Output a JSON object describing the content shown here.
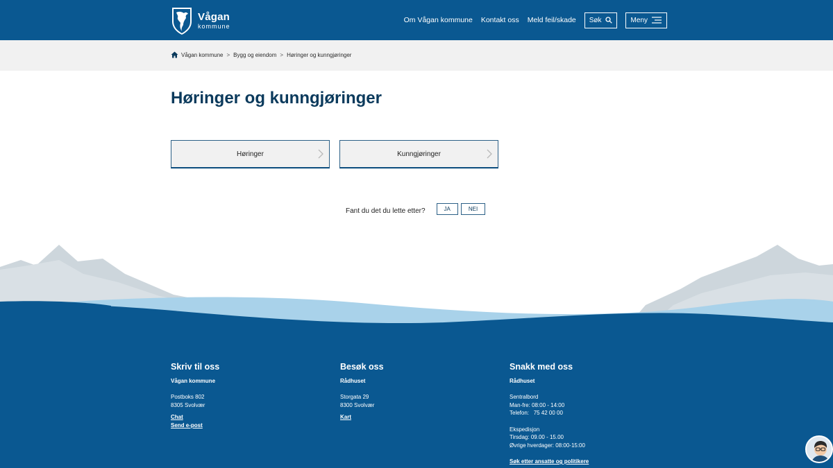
{
  "header": {
    "logo": {
      "title": "Vågan",
      "subtitle": "kommune"
    },
    "nav": {
      "about": "Om Vågan kommune",
      "contact": "Kontakt oss",
      "report": "Meld feil/skade",
      "search": "Søk",
      "menu": "Meny"
    }
  },
  "breadcrumb": {
    "items": [
      "Vågan kommune",
      "Bygg og eiendom",
      "Høringer og kunngjøringer"
    ],
    "separator": ">"
  },
  "main": {
    "title": "Høringer og kunngjøringer",
    "tiles": [
      "Høringer",
      "Kunngjøringer"
    ],
    "feedback": {
      "question": "Fant du det du lette etter?",
      "yes": "JA",
      "no": "NEI"
    }
  },
  "footer": {
    "write": {
      "heading": "Skriv til oss",
      "org": "Vågan kommune",
      "address_1": "Postboks 802",
      "address_2": "8305 Svolvær",
      "chat": "Chat",
      "email": "Send e-post"
    },
    "visit": {
      "heading": "Besøk oss",
      "place": "Rådhuset",
      "address_1": "Storgata 29",
      "address_2": "8300 Svolvær",
      "map": "Kart"
    },
    "talk": {
      "heading": "Snakk med oss",
      "place": "Rådhuset",
      "switchboard": "Sentralbord",
      "hours": "Man-fre: 08:00 - 14:00",
      "phone": "Telefon:   75 42 00 00",
      "expedition": "Ekspedisjon",
      "exp_tue": "Tirsdag: 09.00 - 15.00",
      "exp_other": "Øvrige hverdager: 08:00-15:00",
      "search_staff": "Søk etter ansatte og politikere"
    }
  },
  "colors": {
    "brand_blue": "#0a5891",
    "title_navy": "#0b3a5c",
    "light_water": "#a9d2ea",
    "mountain": "#cdd6dc",
    "crumb_bg": "#f1f1f1"
  },
  "icons": {
    "logo": "municipal-shield-icon",
    "search": "search-icon",
    "menu": "hamburger-icon",
    "home": "home-icon",
    "chevron": "chevron-right-icon",
    "chat": "chat-avatar-icon"
  }
}
